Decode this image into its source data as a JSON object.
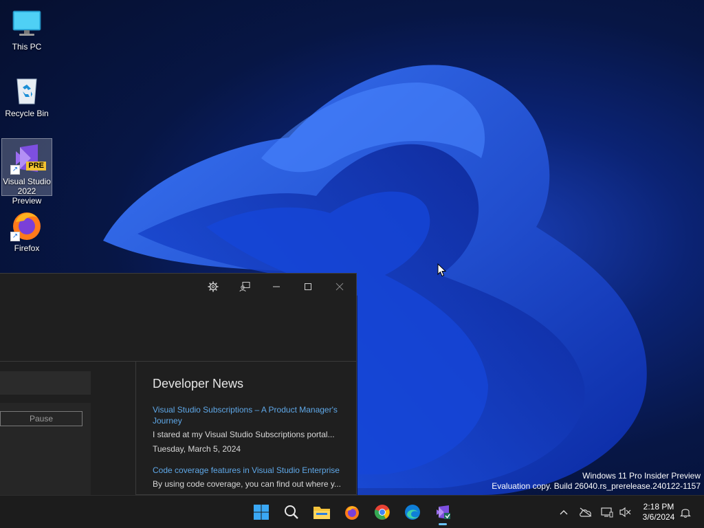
{
  "desktop": {
    "icons": [
      {
        "label": "This PC",
        "icon": "monitor-icon"
      },
      {
        "label": "Recycle Bin",
        "icon": "recycle-bin-icon"
      },
      {
        "label": "Visual Studio 2022 Preview",
        "icon": "visual-studio-preview-icon",
        "badge": "PRE"
      },
      {
        "label": "Firefox",
        "icon": "firefox-icon"
      }
    ]
  },
  "vs_window": {
    "title_buttons": [
      "gear-icon",
      "feedback-icon",
      "minimize-icon",
      "maximize-icon",
      "close-icon"
    ],
    "pause_label": "Pause",
    "news": {
      "heading": "Developer News",
      "items": [
        {
          "title": "Visual Studio Subscriptions – A Product Manager's Journey",
          "desc": "I stared at my Visual Studio Subscriptions portal...",
          "date": "Tuesday, March 5, 2024"
        },
        {
          "title": "Code coverage features in Visual Studio Enterprise",
          "desc": "By using code coverage, you can find out where y..."
        }
      ]
    }
  },
  "watermark": {
    "line1": "Windows 11 Pro Insider Preview",
    "line2": "Evaluation copy. Build 26040.rs_prerelease.240122-1157"
  },
  "taskbar": {
    "apps": [
      "start-icon",
      "search-icon",
      "file-explorer-icon",
      "firefox-icon",
      "chrome-icon",
      "edge-icon",
      "visual-studio-icon"
    ],
    "active_app": "visual-studio-icon",
    "clock": {
      "time": "2:18 PM",
      "date": "3/6/2024"
    }
  },
  "colors": {
    "accent": "#6cc4ff",
    "link": "#5fa8e8",
    "window_bg": "#1f1f1f",
    "taskbar_bg": "#1c1c1c"
  }
}
